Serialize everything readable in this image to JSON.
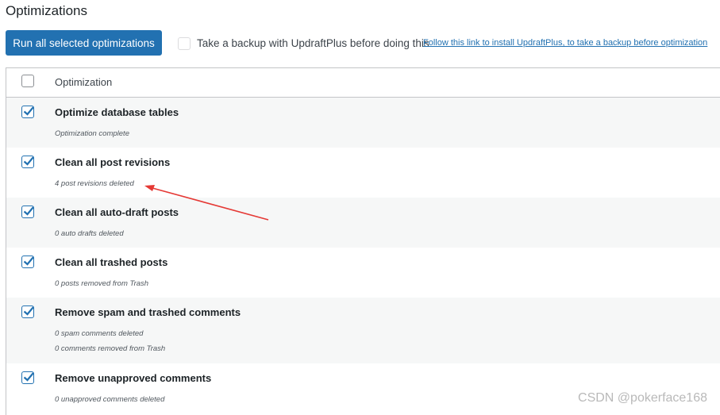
{
  "page": {
    "title": "Optimizations"
  },
  "toolbar": {
    "run_label": "Run all selected optimizations",
    "backup_label": "Take a backup with UpdraftPlus before doing this",
    "backup_link": "Follow this link to install UpdraftPlus, to take a backup before optimization"
  },
  "table": {
    "header": "Optimization",
    "rows": [
      {
        "title": "Optimize database tables",
        "status": [
          "Optimization complete"
        ],
        "checked": true
      },
      {
        "title": "Clean all post revisions",
        "status": [
          "4 post revisions deleted"
        ],
        "checked": true
      },
      {
        "title": "Clean all auto-draft posts",
        "status": [
          "0 auto drafts deleted"
        ],
        "checked": true
      },
      {
        "title": "Clean all trashed posts",
        "status": [
          "0 posts removed from Trash"
        ],
        "checked": true
      },
      {
        "title": "Remove spam and trashed comments",
        "status": [
          "0 spam comments deleted",
          "0 comments removed from Trash"
        ],
        "checked": true
      },
      {
        "title": "Remove unapproved comments",
        "status": [
          "0 unapproved comments deleted"
        ],
        "checked": true
      }
    ]
  },
  "watermark": "CSDN @pokerface168",
  "colors": {
    "accent": "#2271b1",
    "annotation_arrow": "#e53935",
    "row_alt": "#f6f7f7"
  }
}
